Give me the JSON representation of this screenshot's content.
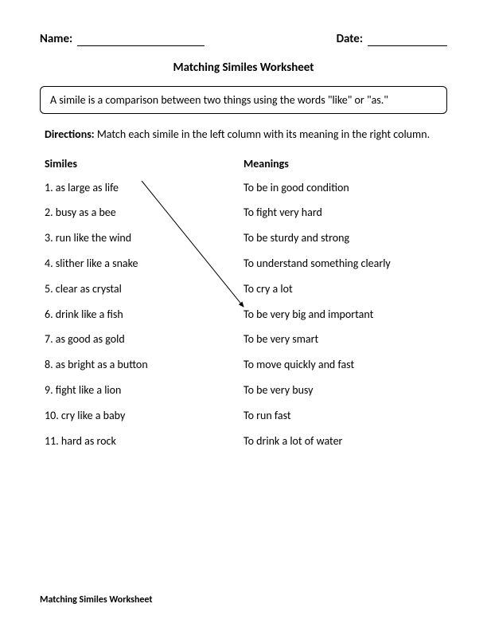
{
  "header": {
    "name_label": "Name:",
    "date_label": "Date:"
  },
  "title": "Matching Similes Worksheet",
  "definition": "A simile is a comparison between two things using the words \"like\" or \"as.\"",
  "directions_label": "Directions:",
  "directions_text": " Match each simile in the left column with its meaning in the right column.",
  "left_header": "Similes",
  "right_header": "Meanings",
  "similes": [
    "1. as large as life",
    "2. busy as a bee",
    "3. run like the wind",
    "4. slither like a snake",
    "5. clear as crystal",
    "6. drink like a fish",
    "7. as good as gold",
    "8. as bright as a button",
    "9. fight like a lion",
    "10. cry like a baby",
    "11. hard as rock"
  ],
  "meanings": [
    "To be in good condition",
    "To fight very hard",
    "To be sturdy and strong",
    "To understand something clearly",
    "To cry a lot",
    "To be very big and important",
    "To be very smart",
    "To move quickly and fast",
    "To be very busy",
    "To run fast",
    "To drink a lot of water"
  ],
  "footer": "Matching Similes Worksheet"
}
